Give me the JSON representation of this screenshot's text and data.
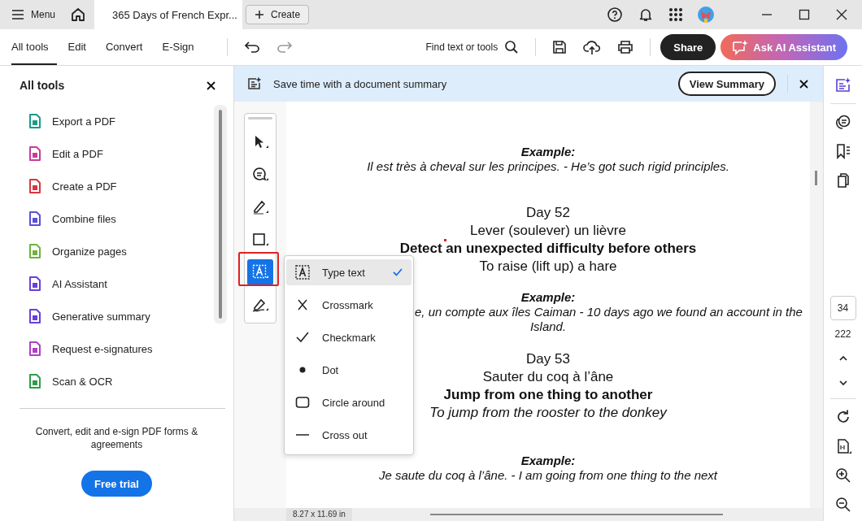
{
  "titlebar": {
    "menu_label": "Menu",
    "tab_title": "365 Days of French Expr...",
    "create_label": "Create"
  },
  "toolbar": {
    "tabs": [
      {
        "label": "All tools",
        "selected": true
      },
      {
        "label": "Edit",
        "selected": false
      },
      {
        "label": "Convert",
        "selected": false
      },
      {
        "label": "E-Sign",
        "selected": false
      }
    ],
    "find_label": "Find text or tools",
    "share_label": "Share",
    "ai_label": "Ask AI Assistant"
  },
  "sidebar": {
    "title": "All tools",
    "items": [
      {
        "label": "Export a PDF",
        "color": "#1a9a8c"
      },
      {
        "label": "Edit a PDF",
        "color": "#c83c9b"
      },
      {
        "label": "Create a PDF",
        "color": "#d7373f"
      },
      {
        "label": "Combine files",
        "color": "#5a4fd8"
      },
      {
        "label": "Organize pages",
        "color": "#6fb33f"
      },
      {
        "label": "AI Assistant",
        "color": "#6a3fd8"
      },
      {
        "label": "Generative summary",
        "color": "#6a3fd8"
      },
      {
        "label": "Request e-signatures",
        "color": "#b03fc8"
      },
      {
        "label": "Scan & OCR",
        "color": "#2d9d4b"
      }
    ],
    "promo_text": "Convert, edit and e-sign PDF forms & agreements",
    "trial_label": "Free trial"
  },
  "banner": {
    "text": "Save time with a document summary",
    "button": "View Summary"
  },
  "tools": [
    {
      "kind": "select",
      "selected": false
    },
    {
      "kind": "comment",
      "selected": false
    },
    {
      "kind": "highlight",
      "selected": false
    },
    {
      "kind": "shape",
      "selected": false
    },
    {
      "kind": "text",
      "selected": true
    },
    {
      "kind": "sign",
      "selected": false
    }
  ],
  "tool_menu": [
    {
      "kind": "text",
      "label": "Type text",
      "selected": true
    },
    {
      "kind": "cross",
      "label": "Crossmark",
      "selected": false
    },
    {
      "kind": "check",
      "label": "Checkmark",
      "selected": false
    },
    {
      "kind": "dot",
      "label": "Dot",
      "selected": false
    },
    {
      "kind": "circle",
      "label": "Circle around",
      "selected": false
    },
    {
      "kind": "line",
      "label": "Cross out",
      "selected": false
    }
  ],
  "document": {
    "blocks": [
      {
        "kind": "example",
        "lines": [
          {
            "kind": "label",
            "text": "Example:"
          },
          {
            "kind": "quote",
            "text": "Il est très à cheval sur les principes. - He’s got such rigid principles."
          }
        ]
      },
      {
        "kind": "day",
        "lines": [
          {
            "kind": "heading",
            "text": "Day 52"
          },
          {
            "kind": "phrase",
            "text": "Lever (soulever) un lièvre"
          },
          {
            "kind": "meaning",
            "text": "Detect an unexpected difficulty before others"
          },
          {
            "kind": "phrase",
            "text": "To raise (lift up) a hare"
          }
        ]
      },
      {
        "kind": "example",
        "lines": [
          {
            "kind": "label",
            "text": "Example:"
          },
          {
            "kind": "cut",
            "text": "e, un compte aux îles Caiman - 10 days ago we found an account in the"
          },
          {
            "kind": "quote",
            "text": "Island."
          }
        ]
      },
      {
        "kind": "day",
        "lines": [
          {
            "kind": "heading",
            "text": "Day 53"
          },
          {
            "kind": "phrase",
            "text": "Sauter du coq à l’âne"
          },
          {
            "kind": "meaning",
            "text": "Jump from one thing to another"
          },
          {
            "kind": "quote",
            "text": "To jump from the rooster to the donkey"
          }
        ]
      },
      {
        "kind": "example",
        "lines": [
          {
            "kind": "label",
            "text": "Example:"
          },
          {
            "kind": "quote",
            "text": "Je saute du coq à l’âne. - I am going from one thing to the next"
          }
        ]
      }
    ],
    "page_size": "8.27 x 11.69 in"
  },
  "page_nav": {
    "current": "34",
    "total": "222"
  }
}
